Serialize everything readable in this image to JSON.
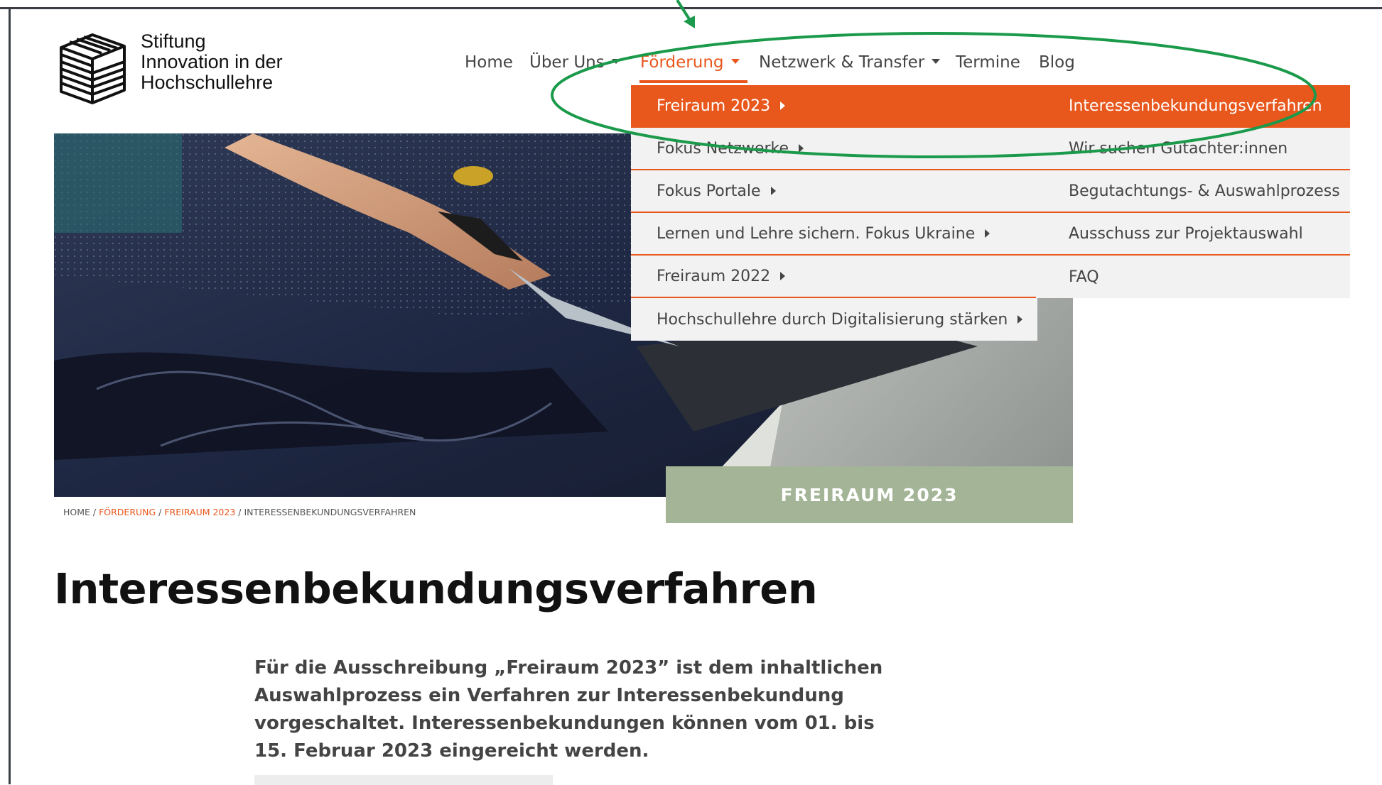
{
  "logo": {
    "icon": "stacked-cube-icon",
    "lines": [
      "Stiftung",
      "Innovation in der",
      "Hochschullehre"
    ]
  },
  "nav": {
    "items": [
      {
        "label": "Home",
        "has_dropdown": false
      },
      {
        "label": "Über Uns",
        "has_dropdown": true
      },
      {
        "label": "Förderung",
        "has_dropdown": true,
        "active": true
      },
      {
        "label": "Netzwerk & Transfer",
        "has_dropdown": true
      },
      {
        "label": "Termine",
        "has_dropdown": false
      },
      {
        "label": "Blog",
        "has_dropdown": false
      }
    ]
  },
  "dropdown": {
    "submenu": [
      {
        "label": "Freiraum 2023",
        "active": true
      },
      {
        "label": "Fokus Netzwerke"
      },
      {
        "label": "Fokus Portale"
      },
      {
        "label": "Lernen und Lehre sichern. Fokus Ukraine"
      },
      {
        "label": "Freiraum 2022"
      },
      {
        "label": "Hochschullehre durch Digitalisierung stärken"
      }
    ],
    "subsubmenu": [
      {
        "label": "Interessenbekundungsverfahren",
        "active": true
      },
      {
        "label": "Wir suchen Gutachter:innen"
      },
      {
        "label": "Begutachtungs- & Auswahlprozess"
      },
      {
        "label": "Ausschuss zur Projektauswahl"
      },
      {
        "label": "FAQ"
      }
    ]
  },
  "hero": {
    "badge": "FREIRAUM 2023"
  },
  "breadcrumb": {
    "home": "HOME",
    "sep": " / ",
    "level1": "FÖRDERUNG",
    "level2": "FREIRAUM 2023",
    "current": "INTERESSENBEKUNDUNGSVERFAHREN"
  },
  "page": {
    "title": "Interessenbekundungsverfahren",
    "intro_lines": [
      "Für die Ausschreibung „Freiraum 2023” ist dem inhaltlichen",
      "Auswahlprozess ein Verfahren zur Interessenbekundung",
      "vorgeschaltet. Interessenbekundungen können vom 01. bis",
      "15. Februar 2023 eingereicht werden."
    ]
  },
  "colors": {
    "accent": "#e8571c",
    "badge": "#a3b596",
    "annotation": "#1a9a4a",
    "menu_bg": "#f2f2f2"
  }
}
